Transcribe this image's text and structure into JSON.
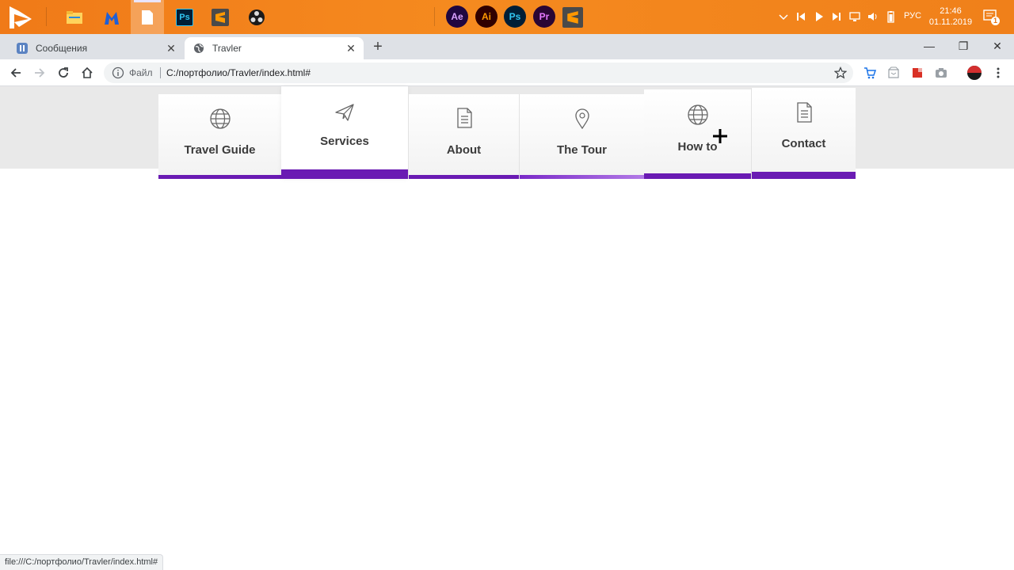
{
  "taskbar": {
    "apps": [
      {
        "name": "file-explorer"
      },
      {
        "name": "malwarebytes"
      },
      {
        "name": "notepad",
        "active": true
      },
      {
        "name": "photoshop-taskbar",
        "label": "Ps"
      },
      {
        "name": "sublime-text"
      },
      {
        "name": "obs-studio"
      }
    ],
    "pinned_adobe": [
      {
        "label": "Ae",
        "color": "#d8a1ff",
        "bg": "#1f0740"
      },
      {
        "label": "Ai",
        "color": "#ff9a00",
        "bg": "#300000"
      },
      {
        "label": "Ps",
        "color": "#31c5f0",
        "bg": "#001e36"
      },
      {
        "label": "Pr",
        "color": "#e579ff",
        "bg": "#2a0634"
      }
    ],
    "lang": "РУС",
    "time": "21:46",
    "date": "01.11.2019",
    "notifications": "1"
  },
  "browser": {
    "tabs": [
      {
        "title": "Сообщения",
        "active": false
      },
      {
        "title": "Travler",
        "active": true
      }
    ],
    "address": {
      "scheme_label": "Файл",
      "url": "C:/портфолио/Travler/index.html#"
    },
    "status_url": "file:///C:/портфолио/Travler/index.html#"
  },
  "site": {
    "accent": "#6a1bb3",
    "nav": [
      {
        "label": "Travel Guide",
        "icon": "globe-icon"
      },
      {
        "label": "Services",
        "icon": "paper-plane-icon",
        "state": "active"
      },
      {
        "label": "About",
        "icon": "document-icon"
      },
      {
        "label": "The Tour",
        "icon": "map-pin-icon"
      },
      {
        "label": "How to",
        "icon": "globe-icon",
        "state": "hover"
      },
      {
        "label": "Contact",
        "icon": "document-icon"
      }
    ]
  }
}
